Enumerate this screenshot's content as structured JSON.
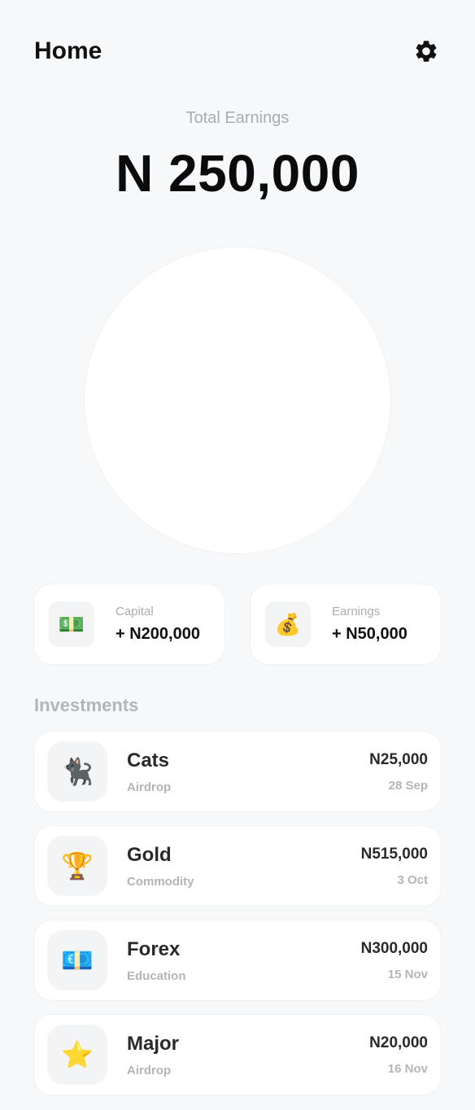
{
  "header": {
    "title": "Home",
    "settings_icon": "gear-icon"
  },
  "summary": {
    "total_label": "Total Earnings",
    "total_value": "N 250,000"
  },
  "cards": [
    {
      "label": "Capital",
      "value": "+ N200,000",
      "icon": "money-bill-icon",
      "emoji": "💵"
    },
    {
      "label": "Earnings",
      "value": "+ N50,000",
      "icon": "money-bag-icon",
      "emoji": "💰"
    }
  ],
  "investments": {
    "title": "Investments",
    "items": [
      {
        "name": "Cats",
        "category": "Airdrop",
        "amount": "N25,000",
        "date": "28 Sep",
        "icon": "cat-icon",
        "emoji": "🐈‍⬛"
      },
      {
        "name": "Gold",
        "category": "Commodity",
        "amount": "N515,000",
        "date": "3 Oct",
        "icon": "trophy-icon",
        "emoji": "🏆"
      },
      {
        "name": "Forex",
        "category": "Education",
        "amount": "N300,000",
        "date": "15 Nov",
        "icon": "euro-banknote-icon",
        "emoji": "💶"
      },
      {
        "name": "Major",
        "category": "Airdrop",
        "amount": "N20,000",
        "date": "16 Nov",
        "icon": "star-icon",
        "emoji": "⭐"
      }
    ]
  }
}
